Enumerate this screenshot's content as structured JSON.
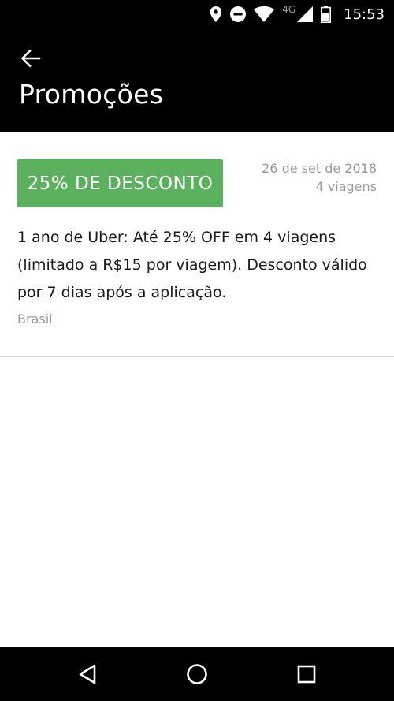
{
  "status_bar": {
    "time": "15:53",
    "network_label": "4G",
    "icons": [
      "location-icon",
      "do-not-disturb-icon",
      "wifi-icon",
      "cell-signal-icon",
      "battery-icon"
    ]
  },
  "app_bar": {
    "title": "Promoções",
    "back_icon": "arrow-left-icon"
  },
  "promo": {
    "badge": "25% DE DESCONTO",
    "badge_color": "#5bb15e",
    "date": "26 de set de 2018",
    "trips": "4 viagens",
    "description": "1 ano de Uber: Até 25% OFF em 4 viagens (limitado a R$15 por viagem). Desconto válido por 7 dias após a aplicação.",
    "country": "Brasil"
  },
  "nav_bar": {
    "icons": [
      "nav-back-icon",
      "nav-home-icon",
      "nav-recents-icon"
    ]
  }
}
